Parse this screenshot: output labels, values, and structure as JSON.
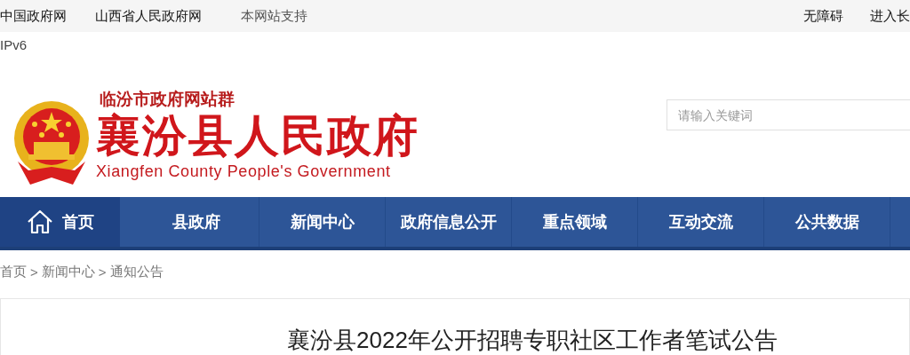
{
  "top_bar": {
    "left_links": [
      {
        "label": "中国政府网",
        "muted": false
      },
      {
        "label": "山西省人民政府网",
        "muted": false
      },
      {
        "label": "本网站支持",
        "muted": true
      }
    ],
    "right_links": [
      "无障碍",
      "进入长"
    ]
  },
  "ipv6": "IPv6",
  "header": {
    "group": "临汾市政府网站群",
    "title": "襄汾县人民政府",
    "subtitle": "Xiangfen County People's Government"
  },
  "search": {
    "placeholder": "请输入关键词"
  },
  "nav": [
    {
      "label": "首页",
      "selected": true,
      "kind": "home"
    },
    {
      "label": "县政府",
      "selected": false,
      "kind": "text"
    },
    {
      "label": "新闻中心",
      "selected": false,
      "kind": "text"
    },
    {
      "label": "政府信息公开",
      "selected": false,
      "kind": "text"
    },
    {
      "label": "重点领域",
      "selected": false,
      "kind": "text"
    },
    {
      "label": "互动交流",
      "selected": false,
      "kind": "text"
    },
    {
      "label": "公共数据",
      "selected": false,
      "kind": "text"
    }
  ],
  "breadcrumb": {
    "items": [
      "首页",
      "新闻中心",
      "通知公告"
    ],
    "separator": ">"
  },
  "article": {
    "title": "襄汾县2022年公开招聘专职社区工作者笔试公告"
  }
}
